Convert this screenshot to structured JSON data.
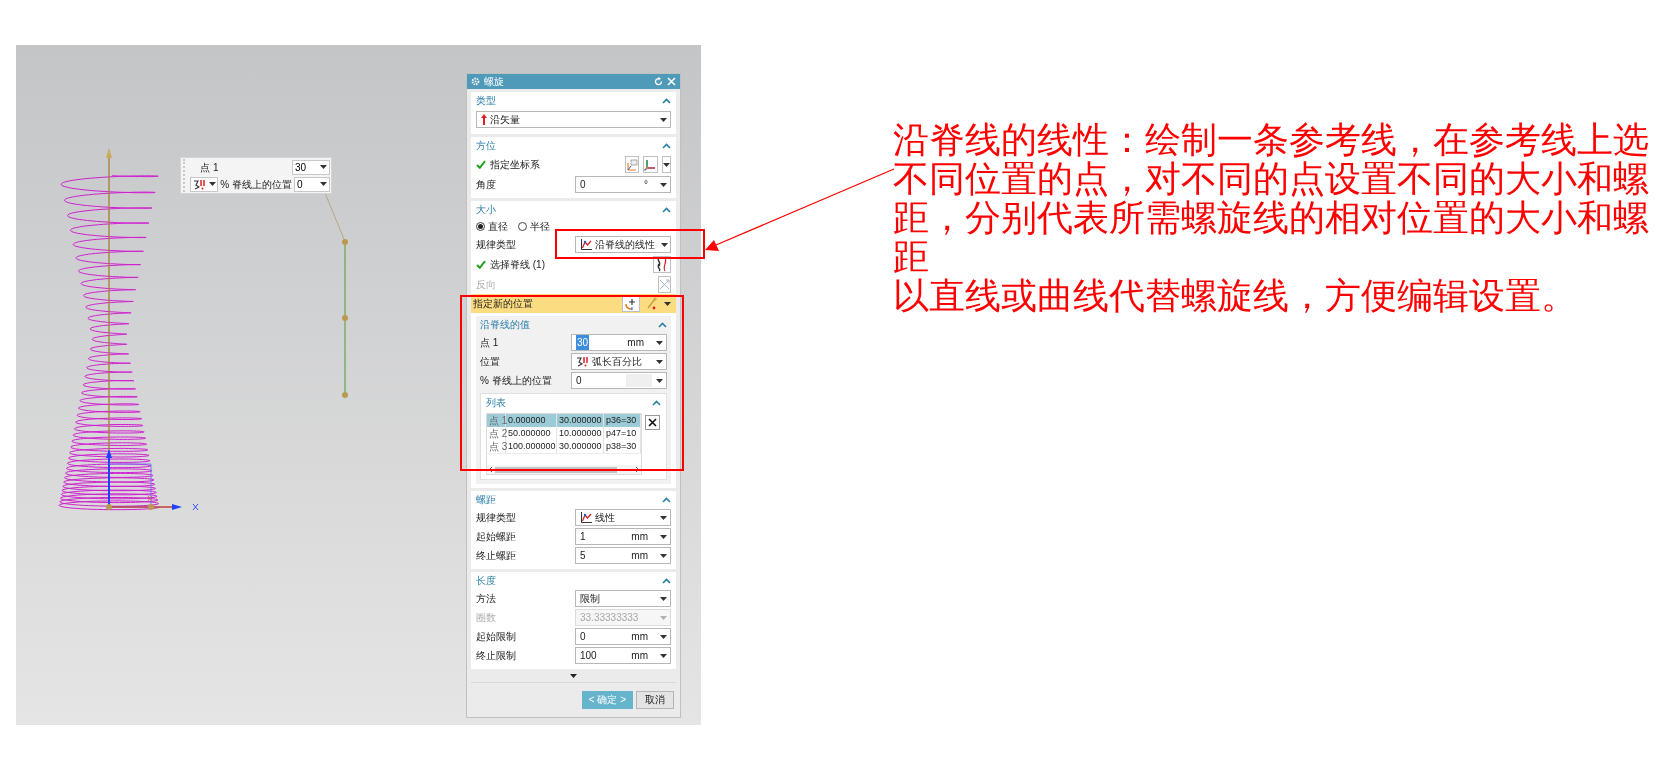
{
  "viewport": {
    "popup": {
      "point_label": "点 1",
      "point_value": "30",
      "position_label": "% 脊线上的位置",
      "position_value": "0"
    }
  },
  "dialog": {
    "title": "螺旋",
    "sections": [
      {
        "title": "类型",
        "expanded": true,
        "rows": [
          {
            "kind": "direction_select",
            "value": "沿矢量"
          }
        ]
      },
      {
        "title": "方位",
        "expanded": true,
        "rows": [
          {
            "kind": "csys",
            "label": "指定坐标系",
            "done": true
          },
          {
            "kind": "field",
            "label": "角度",
            "value": "0",
            "unit": "°",
            "disabled": false,
            "text_selected": false
          }
        ]
      },
      {
        "title": "大小",
        "expanded": true,
        "rows": [
          {
            "kind": "radio",
            "options": [
              {
                "label": "直径",
                "selected": true
              },
              {
                "label": "半径",
                "selected": false
              }
            ]
          },
          {
            "kind": "law_select",
            "label": "规律类型",
            "value": "沿脊线的线性"
          },
          {
            "kind": "curve",
            "label": "选择脊线 (1)",
            "done": true
          },
          {
            "kind": "reverse",
            "label": "反向",
            "disabled": true
          },
          {
            "kind": "new_location",
            "label": "指定新的位置",
            "highlighted": true
          },
          {
            "kind": "group",
            "title": "沿脊线的值",
            "expanded": true,
            "rows": [
              {
                "kind": "field",
                "label": "点 1",
                "value": "30",
                "unit": "mm",
                "disabled": false,
                "text_selected": true
              },
              {
                "kind": "position_select",
                "label": "位置",
                "value": "弧长百分比"
              },
              {
                "kind": "field",
                "label": "% 脊线上的位置",
                "value": "0",
                "disabled": false,
                "text_selected": false
              },
              {
                "kind": "list",
                "title": "列表",
                "expanded": true,
                "rows": [
                  {
                    "cells": [
                      "点 1",
                      "0.000000",
                      "30.000000",
                      "p36=30"
                    ],
                    "selected": true
                  },
                  {
                    "cells": [
                      "点 2",
                      "50.000000",
                      "10.000000",
                      "p47=10"
                    ],
                    "selected": false
                  },
                  {
                    "cells": [
                      "点 3",
                      "100.000000",
                      "30.000000",
                      "p38=30"
                    ],
                    "selected": false
                  }
                ]
              }
            ]
          }
        ]
      },
      {
        "title": "螺距",
        "expanded": true,
        "rows": [
          {
            "kind": "law_select",
            "label": "规律类型",
            "value": "线性"
          },
          {
            "kind": "field",
            "label": "起始螺距",
            "value": "1",
            "unit": "mm",
            "disabled": false,
            "text_selected": false
          },
          {
            "kind": "field",
            "label": "终止螺距",
            "value": "5",
            "unit": "mm",
            "disabled": false,
            "text_selected": false
          }
        ]
      },
      {
        "title": "长度",
        "expanded": true,
        "rows": [
          {
            "kind": "select",
            "label": "方法",
            "value": "限制"
          },
          {
            "kind": "field",
            "label": "圈数",
            "value": "33.33333333",
            "disabled": true,
            "text_selected": false
          },
          {
            "kind": "field",
            "label": "起始限制",
            "value": "0",
            "unit": "mm",
            "disabled": false,
            "text_selected": false
          },
          {
            "kind": "field",
            "label": "终止限制",
            "value": "100",
            "unit": "mm",
            "disabled": false,
            "text_selected": false
          }
        ]
      }
    ],
    "buttons": [
      {
        "label": "< 确定 >",
        "primary": true
      },
      {
        "label": "取消",
        "primary": false
      }
    ]
  },
  "annotation": {
    "paragraphs": [
      "沿脊线的线性：绘制一条参考线，在参考线上选不同位置的点，对不同的点设置不同的大小和螺距，分别代表所需螺旋线的相对位置的大小和螺距",
      "以直线或曲线代替螺旋线，方便编辑设置。"
    ]
  }
}
